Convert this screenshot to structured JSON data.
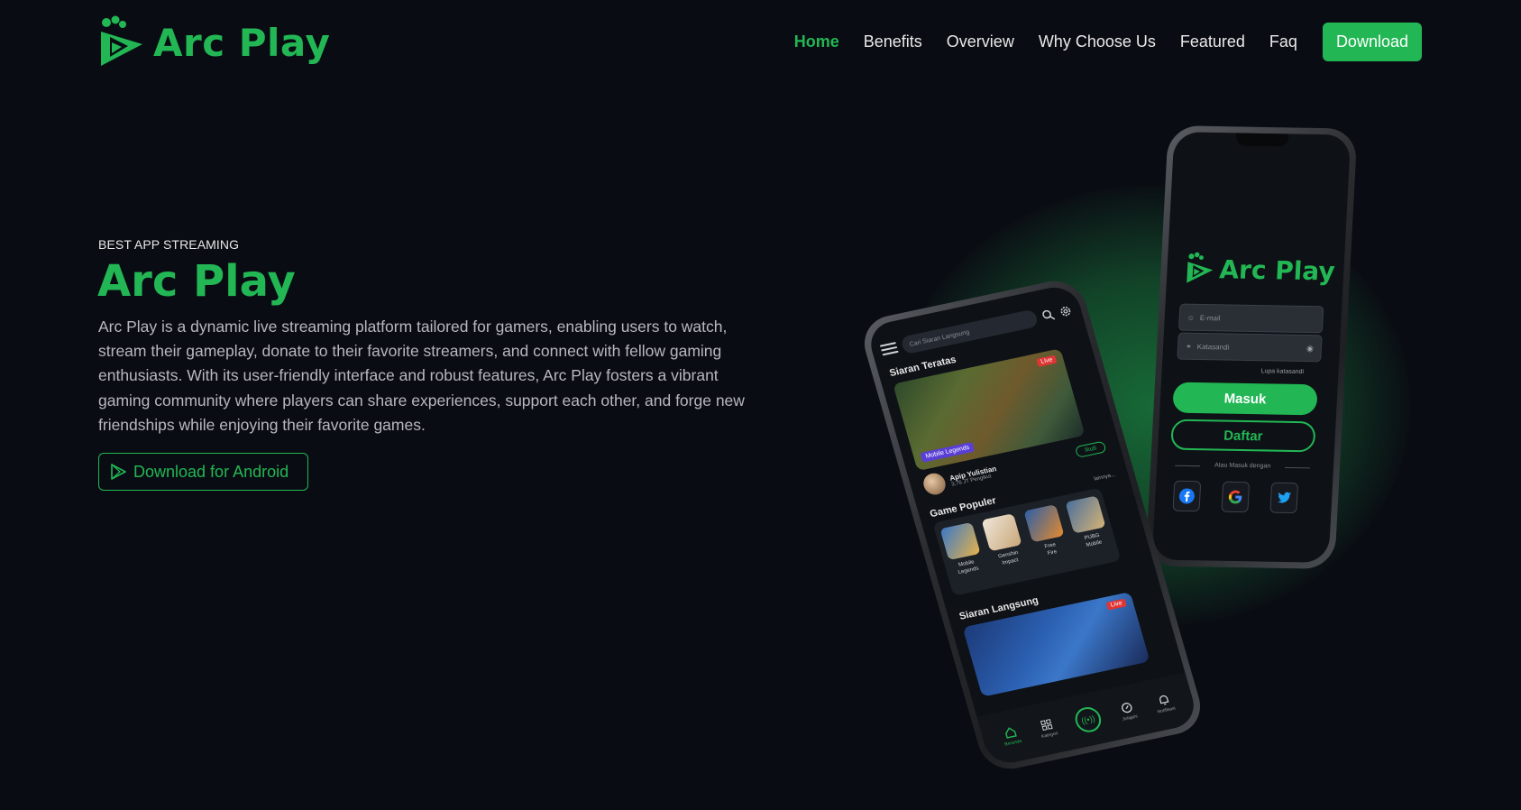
{
  "brand": {
    "name": "Arc Play",
    "accent_color": "#22b754",
    "background": "#0a0c13"
  },
  "nav": {
    "links": [
      "Home",
      "Benefits",
      "Overview",
      "Why Choose Us",
      "Featured",
      "Faq"
    ],
    "active": "Home",
    "download_label": "Download"
  },
  "hero": {
    "eyebrow": "BEST APP STREAMING",
    "title": "Arc Play",
    "description": "Arc Play is a dynamic live streaming platform tailored for gamers, enabling users to watch, stream their gameplay, donate to their favorite streamers, and connect with fellow gaming enthusiasts. With its user-friendly interface and robust features, Arc Play fosters a vibrant gaming community where players can share experiences, support each other, and forge new friendships while enjoying their favorite games.",
    "cta_label": "Download for Android"
  },
  "phone_login": {
    "logo_text": "Arc Play",
    "email_placeholder": "E-mail",
    "password_placeholder": "Katasandi",
    "forgot_label": "Lupa katasandi",
    "login_label": "Masuk",
    "register_label": "Daftar",
    "divider_label": "Atau Masuk dengan",
    "social_icons": [
      "facebook-icon",
      "google-icon",
      "twitter-icon"
    ]
  },
  "phone_app": {
    "search_placeholder": "Cari Siaran Langsung",
    "section_top": "Siaran Teratas",
    "game_tag": "Mobile Legends",
    "live_badge": "Live",
    "streamer_name": "Apip Yulistian",
    "streamer_followers": "3,76 JT Pengikut",
    "follow_label": "Ikuti",
    "section_popular": "Game Populer",
    "more_label": "lainnya...",
    "games": [
      {
        "l1": "Mobile",
        "l2": "Legends"
      },
      {
        "l1": "Genshin",
        "l2": "Impact"
      },
      {
        "l1": "Free",
        "l2": "Fire"
      },
      {
        "l1": "PUBG",
        "l2": "Mobile"
      }
    ],
    "section_live": "Siaran Langsung",
    "bottom_nav": [
      "Beranda",
      "Kategori",
      "Jelajahi",
      "Notifikasi"
    ]
  }
}
